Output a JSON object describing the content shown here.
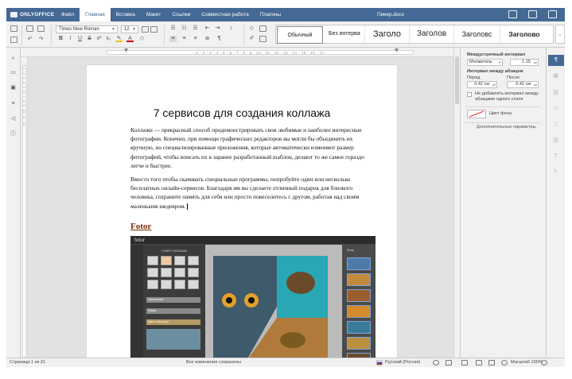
{
  "app": {
    "brand": "ONLYOFFICE",
    "doc_title": "Пикер.docx",
    "accent": "#446995"
  },
  "menu": {
    "tabs": [
      "Файл",
      "Главная",
      "Вставка",
      "Макет",
      "Ссылки",
      "Совместная работа",
      "Плагины"
    ],
    "active_tab": "Главная"
  },
  "toolbar": {
    "font_name": "Times New Roman",
    "font_size": "12",
    "styles": [
      "Обычный",
      "Без интерва",
      "Заголо",
      "Заголов",
      "Заголовс",
      "Заголово"
    ],
    "selected_style": "Обычный",
    "icons": [
      "copy-icon",
      "paste-icon",
      "print-icon",
      "save-icon",
      "undo-icon",
      "redo-icon",
      "bold-icon",
      "italic-icon",
      "underline-icon",
      "strikethrough-icon",
      "superscript-icon",
      "subscript-icon",
      "highlight-icon",
      "font-color-icon",
      "bullets-icon",
      "numbering-icon",
      "multilevel-icon",
      "decrease-indent-icon",
      "increase-indent-icon",
      "align-left-icon",
      "align-center-icon",
      "align-right-icon",
      "justify-icon",
      "line-spacing-icon",
      "nonprinting-icon",
      "shading-icon",
      "copy-style-icon",
      "clear-style-icon"
    ]
  },
  "document": {
    "title": "7 сервисов для создания коллажа",
    "paragraph1": "Коллажи — прекрасный способ продемонстрировать свои любимые и наиболее интересные фотографии. Конечно, при помощи графических редакторов вы могли бы объединить их вручную, но специализированные приложения, которые автоматически изменяют размер фотографий, чтобы вписать их в заранее разработанный шаблон, делают то же самое гораздо легче и быстрее.",
    "paragraph2": "Вместо того чтобы скачивать специальные программы, попробуйте один или несколько бесплатных онлайн-сервисов. Благодаря им вы сделаете отличный подарок для близкого человека, сохраните память для себя или просто повеселитесь с другом, работая над своим маленьким шедевром.",
    "heading2": "Fotor",
    "embedded": {
      "logo": "fotor",
      "panel_title": "FUNKY КОЛЛАЖ",
      "panel_bars": [
        "Заполнение",
        "Рамка",
        "Цвет и текстура"
      ],
      "side_label": "Фоны"
    }
  },
  "right_panel": {
    "line_spacing_label": "Междустрочный интервал",
    "line_spacing_type": "Множитель",
    "line_spacing_value": "1.15",
    "para_spacing_label": "Интервал между абзацем",
    "before_label": "Перед",
    "after_label": "После",
    "before_value": "0.42 см",
    "after_value": "0.42 см",
    "no_space_label_1": "Не добавлять интервал между",
    "no_space_label_2": "абзацами одного стиля",
    "background_color_label": "Цвет фона",
    "advanced_link": "Дополнительные параметры",
    "rail_icons": [
      "paragraph-settings-icon",
      "table-settings-icon",
      "image-settings-icon",
      "header-footer-icon",
      "shape-settings-icon",
      "chart-settings-icon",
      "textart-icon",
      "signature-icon"
    ]
  },
  "left_panel": {
    "icons": [
      "search-icon",
      "comments-icon",
      "chat-icon",
      "navigation-icon",
      "feedback-icon",
      "about-icon"
    ]
  },
  "status": {
    "page": "Страница 1 из 21",
    "saved": "Все изменения сохранены",
    "language": "Русский (Россия)",
    "zoom": "Масштаб 100%"
  }
}
